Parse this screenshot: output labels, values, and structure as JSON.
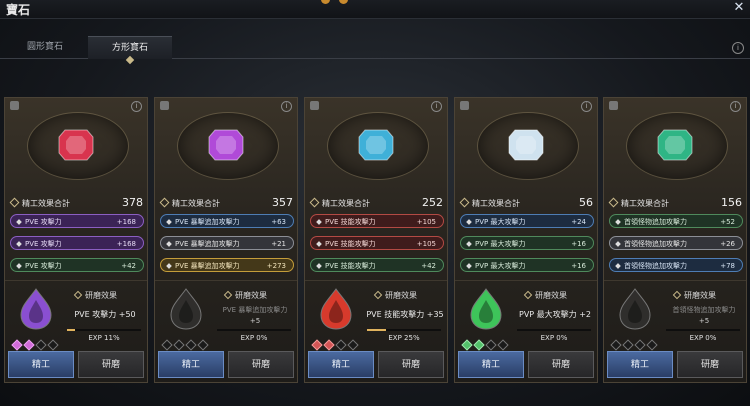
{
  "window": {
    "title": "寶石",
    "close_icon": "close-icon"
  },
  "tabs": [
    {
      "label": "圓形寶石",
      "active": false
    },
    {
      "label": "方形寶石",
      "active": true
    }
  ],
  "total_label": "精工效果合計",
  "polish_label": "研磨效果",
  "buttons": {
    "craft": "精工",
    "polish": "研磨"
  },
  "cards": [
    {
      "gem_color": "#d8344e",
      "total": "378",
      "stats": [
        {
          "label": "PVE 攻擊力",
          "value": "+168",
          "style": "purple"
        },
        {
          "label": "PVE 攻擊力",
          "value": "+168",
          "style": "purple"
        },
        {
          "label": "PVE 攻擊力",
          "value": "+42",
          "style": "green"
        }
      ],
      "polish_stat": "PVE 攻擊力 +50",
      "polish_val": "",
      "exp_text": "EXP 11%",
      "exp": 11,
      "polish_color": "#8a4fd1",
      "pips": 2,
      "pip_style": "purple"
    },
    {
      "gem_color": "#b04ad8",
      "total": "357",
      "stats": [
        {
          "label": "PVE 暴擊追加攻擊力",
          "value": "+63",
          "style": "blue"
        },
        {
          "label": "PVE 暴擊追加攻擊力",
          "value": "+21",
          "style": "gray"
        },
        {
          "label": "PVE 暴擊追加攻擊力",
          "value": "+273",
          "style": "gold"
        }
      ],
      "polish_stat": "PVE 暴擊追加攻擊力",
      "polish_val": "+5",
      "exp_text": "EXP 0%",
      "exp": 0,
      "polish_color": "",
      "pips": 0,
      "pip_style": ""
    },
    {
      "gem_color": "#3fb0d8",
      "total": "252",
      "stats": [
        {
          "label": "PVE 技能攻擊力",
          "value": "+105",
          "style": "red"
        },
        {
          "label": "PVE 技能攻擊力",
          "value": "+105",
          "style": "red"
        },
        {
          "label": "PVE 技能攻擊力",
          "value": "+42",
          "style": "green"
        }
      ],
      "polish_stat": "PVE 技能攻擊力 +35",
      "polish_val": "",
      "exp_text": "EXP 25%",
      "exp": 25,
      "polish_color": "#d73a2c",
      "pips": 2,
      "pip_style": "red"
    },
    {
      "gem_color": "#cfe2ef",
      "total": "56",
      "stats": [
        {
          "label": "PVP 最大攻擊力",
          "value": "+24",
          "style": "blue"
        },
        {
          "label": "PVP 最大攻擊力",
          "value": "+16",
          "style": "green"
        },
        {
          "label": "PVP 最大攻擊力",
          "value": "+16",
          "style": "green"
        }
      ],
      "polish_stat": "PVP 最大攻擊力 +2",
      "polish_val": "",
      "exp_text": "EXP 0%",
      "exp": 0,
      "polish_color": "#3ec45a",
      "pips": 2,
      "pip_style": "green"
    },
    {
      "gem_color": "#2fb585",
      "total": "156",
      "stats": [
        {
          "label": "首領怪物追加攻擊力",
          "value": "+52",
          "style": "green"
        },
        {
          "label": "首領怪物追加攻擊力",
          "value": "+26",
          "style": "gray"
        },
        {
          "label": "首領怪物追加攻擊力",
          "value": "+78",
          "style": "blue"
        }
      ],
      "polish_stat": "首領怪物追加攻擊力",
      "polish_val": "+5",
      "exp_text": "EXP 0%",
      "exp": 0,
      "polish_color": "",
      "pips": 0,
      "pip_style": ""
    }
  ]
}
